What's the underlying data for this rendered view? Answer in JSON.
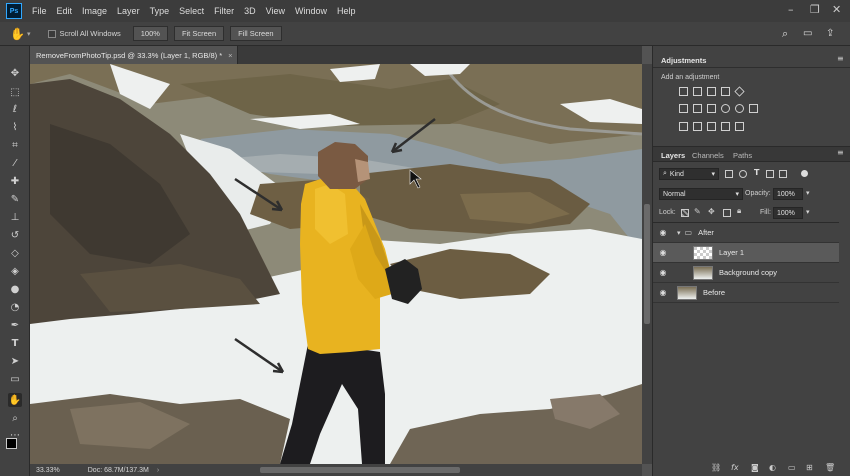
{
  "app": {
    "logo": "Ps"
  },
  "menu": [
    "File",
    "Edit",
    "Image",
    "Layer",
    "Type",
    "Select",
    "Filter",
    "3D",
    "View",
    "Window",
    "Help"
  ],
  "options": {
    "scroll_all": "Scroll All Windows",
    "zoom": "100%",
    "fit": "Fit Screen",
    "fill": "Fill Screen"
  },
  "document": {
    "tab_title": "RemoveFromPhotoTip.psd @ 33.3% (Layer 1, RGB/8) *",
    "close": "×"
  },
  "status": {
    "zoom": "33.33%",
    "doc": "Doc: 68.7M/137.3M"
  },
  "adjustments": {
    "title": "Adjustments",
    "subtitle": "Add an adjustment"
  },
  "layers_panel": {
    "tabs": [
      "Layers",
      "Channels",
      "Paths"
    ],
    "kind": "Kind",
    "blend": "Normal",
    "opacity_label": "Opacity:",
    "opacity": "100%",
    "lock_label": "Lock:",
    "fill_label": "Fill:",
    "fill": "100%",
    "layers": [
      {
        "name": "After",
        "type": "group"
      },
      {
        "name": "Layer 1",
        "type": "layer",
        "selected": true
      },
      {
        "name": "Background copy",
        "type": "layer"
      },
      {
        "name": "Before",
        "type": "layer"
      }
    ]
  },
  "icons": [
    "hand-icon",
    "search-icon",
    "workspace-icon",
    "share-icon",
    "move-icon",
    "marquee-icon",
    "lasso-icon",
    "crop-icon",
    "eyedropper-icon",
    "brush-icon",
    "eraser-icon",
    "text-icon",
    "zoom-icon",
    "eye-icon",
    "folder-icon"
  ],
  "colors": {
    "accent": "#31a8ff",
    "jacket": "#e8b320",
    "snow": "#edf0ef"
  }
}
